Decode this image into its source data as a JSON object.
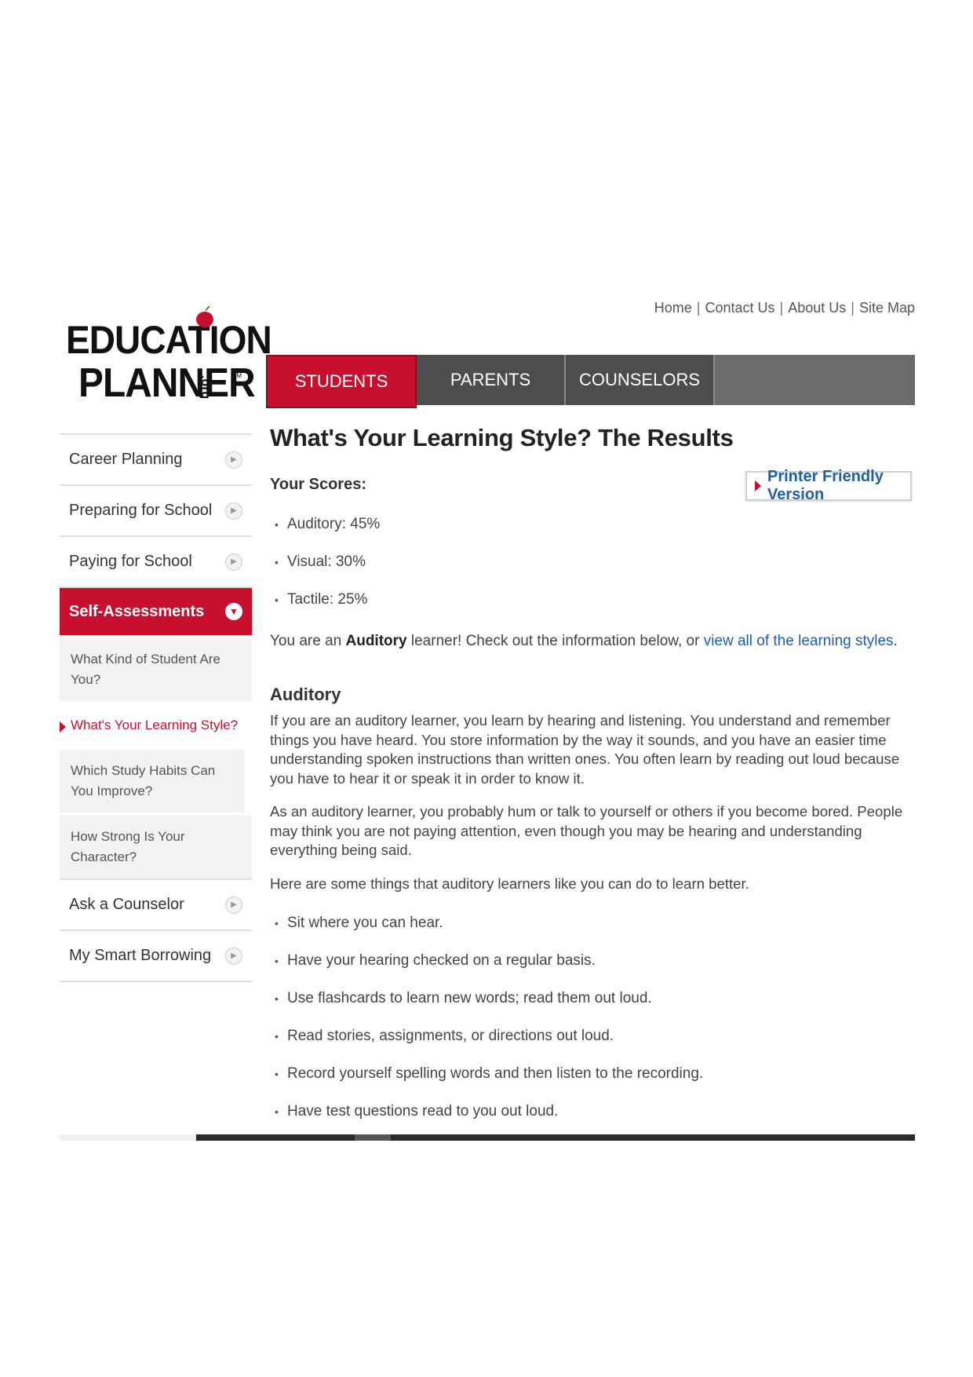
{
  "logo": {
    "line1": "EDUCATION",
    "line2": "PLANNER",
    "org": ".org",
    "sm": "SM"
  },
  "utility_links": [
    "Home",
    "Contact Us",
    "About Us",
    "Site Map"
  ],
  "main_nav": {
    "tabs": [
      {
        "label": "STUDENTS",
        "active": true
      },
      {
        "label": "PARENTS",
        "active": false
      },
      {
        "label": "COUNSELORS",
        "active": false
      }
    ]
  },
  "sidebar": {
    "items": [
      {
        "label": "Career Planning"
      },
      {
        "label": "Preparing for School"
      },
      {
        "label": "Paying for School"
      },
      {
        "label": "Self-Assessments",
        "active": true
      }
    ],
    "sub_items": [
      {
        "label": "What Kind of Student Are You?"
      },
      {
        "label": "What's Your Learning Style?",
        "current": true
      },
      {
        "label": "Which Study Habits Can You Improve?"
      },
      {
        "label": "How Strong Is Your Character?"
      }
    ],
    "items_after": [
      {
        "label": "Ask a Counselor"
      },
      {
        "label": "My Smart Borrowing"
      }
    ]
  },
  "content": {
    "title": "What's Your Learning Style? The Results",
    "scores_label": "Your Scores:",
    "printer_button": "Printer Friendly Version",
    "scores": [
      {
        "text": "Auditory: 45%"
      },
      {
        "text": "Visual: 30%"
      },
      {
        "text": "Tactile: 25%"
      }
    ],
    "learner_prefix": "You are an ",
    "learner_type": "Auditory",
    "learner_middle": " learner! Check out the information below, or ",
    "learner_link": "view all of the learning styles",
    "learner_suffix": ".",
    "section_title": "Auditory",
    "paragraphs": [
      "If you are an auditory learner, you learn by hearing and listening. You understand and remember things you have heard. You store information by the way it sounds, and you have an easier time understanding spoken instructions than written ones. You often learn by reading out loud because you have to hear it or speak it in order to know it.",
      "As an auditory learner, you probably hum or talk to yourself or others if you become bored. People may think you are not paying attention, even though you may be hearing and understanding everything being said.",
      "Here are some things that auditory learners like you can do to learn better."
    ],
    "tips": [
      "Sit where you can hear.",
      "Have your hearing checked on a regular basis.",
      "Use flashcards to learn new words; read them out loud.",
      "Read stories, assignments, or directions out loud.",
      "Record yourself spelling words and then listen to the recording.",
      "Have test questions read to you out loud."
    ]
  },
  "colors": {
    "brand_red": "#c8102e",
    "link_blue": "#1f5fa8",
    "nav_gray": "#4d4d4d"
  }
}
